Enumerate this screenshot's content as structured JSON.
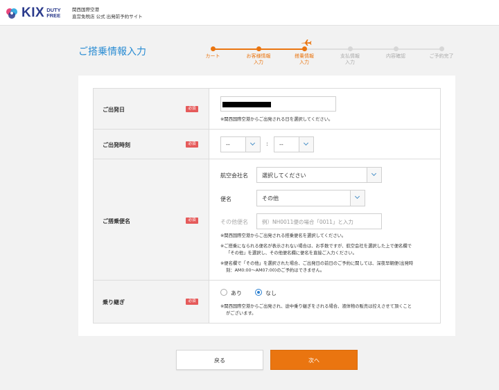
{
  "header": {
    "logo_text": "KIX",
    "logo_duty": "DUTY",
    "logo_free": "FREE",
    "sub_line1": "関西国際空港",
    "sub_line2": "直営免税店 公式 出発前予約サイト"
  },
  "page": {
    "title": "ご搭乗情報入力"
  },
  "progress": {
    "steps": [
      {
        "label": "カート",
        "state": "done"
      },
      {
        "label": "お客様情報\n入力",
        "state": "done"
      },
      {
        "label": "搭乗情報\n入力",
        "state": "current"
      },
      {
        "label": "支払情報\n入力",
        "state": "todo"
      },
      {
        "label": "内容確認",
        "state": "todo"
      },
      {
        "label": "ご予約完了",
        "state": "todo"
      }
    ],
    "current_icon": "airplane-icon"
  },
  "form": {
    "required_badge": "必須",
    "departure_date": {
      "label": "ご出発日",
      "note": "※関西国際空港からご出発される日を選択してください。"
    },
    "departure_time": {
      "label": "ご出発時刻",
      "hour_value": "--",
      "minute_value": "--",
      "separator": ":"
    },
    "flight": {
      "label": "ご搭乗便名",
      "airline_label": "航空会社名",
      "airline_value": "選択してください",
      "flight_no_label": "便名",
      "flight_no_value": "その他",
      "other_label": "その他便名",
      "other_placeholder": "例）NH0011便の場合「0011」と入力",
      "note1": "※関西国際空港からご出発される搭乗便名を選択してください。",
      "note2a": "※ご搭乗になられる便名が表示されない場合は、お手数ですが、航空会社を選択した上で便名欄で",
      "note2b": "「その他」を選択し、その他便名欄に便名を直接ご入力ください。",
      "note3a": "※便名欄で「その他」を選択された場合、ご出発日の前日のご予約に関しては、深夜早朝便(出発時",
      "note3b": "刻：AM0:00～AM07:00)のご予約はできません。"
    },
    "transit": {
      "label": "乗り継ぎ",
      "option_yes": "あり",
      "option_no": "なし",
      "selected": "なし",
      "note_a": "※関西国際空港からご出発され、途中乗り継ぎをされる場合、液体物の販売は控えさせて頂くこと",
      "note_b": "がございます。"
    }
  },
  "buttons": {
    "back": "戻る",
    "next": "次へ"
  },
  "colors": {
    "accent_orange": "#ea7510",
    "title_blue": "#2a8cd3",
    "required_red": "#e55a5a",
    "logo_navy": "#2b3b8c"
  }
}
